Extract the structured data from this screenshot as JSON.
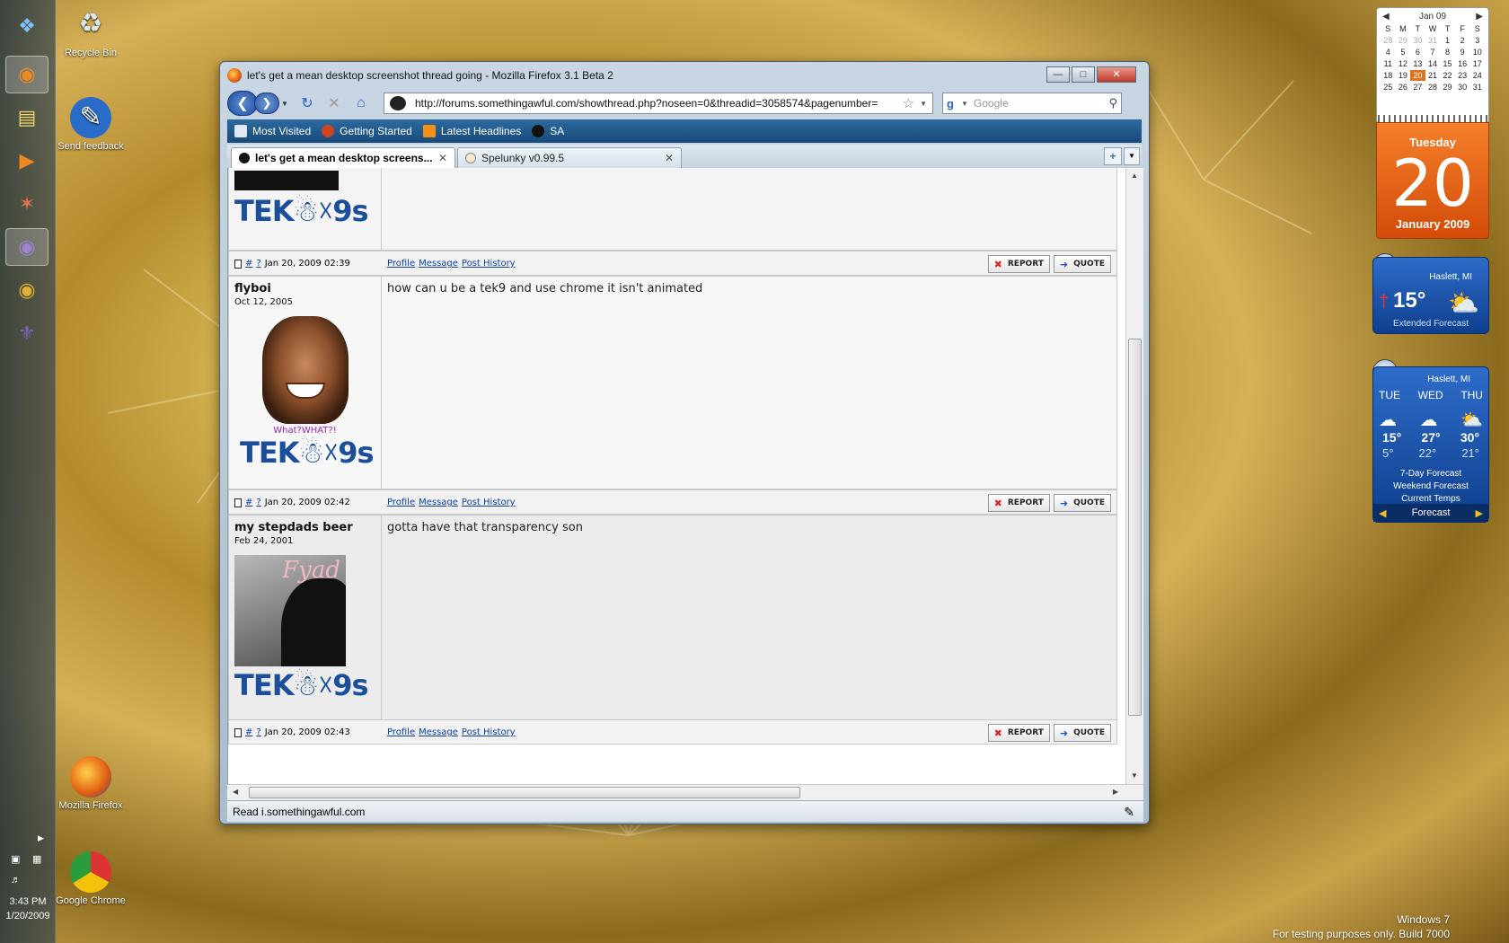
{
  "desktop": {
    "icons": [
      {
        "label": "Recycle Bin"
      },
      {
        "label": "Send feedback"
      },
      {
        "label": "Mozilla Firefox"
      },
      {
        "label": "Google Chrome"
      }
    ],
    "watermark": {
      "line1": "Windows 7",
      "line2": "For testing purposes only. Build 7000"
    }
  },
  "taskbar": {
    "clock_time": "3:43 PM",
    "clock_date": "1/20/2009"
  },
  "browser": {
    "window_title": "let's get a mean desktop screenshot thread going - Mozilla Firefox 3.1 Beta 2",
    "url": "http://forums.somethingawful.com/showthread.php?noseen=0&threadid=3058574&pagenumber=",
    "search_placeholder": "Google",
    "bookmarks": [
      "Most Visited",
      "Getting Started",
      "Latest Headlines",
      "SA"
    ],
    "tabs": [
      {
        "label": "let's get a mean desktop screens...",
        "selected": true
      },
      {
        "label": "Spelunky v0.99.5",
        "selected": false
      }
    ],
    "status": "Read i.somethingawful.com"
  },
  "forum": {
    "sig_text": "TEK☃☓9s",
    "footer_links": {
      "profile": "Profile",
      "message": "Message",
      "history": "Post History"
    },
    "footer_buttons": {
      "report": "REPORT",
      "quote": "QUOTE"
    },
    "footer_marks": {
      "hash": "#",
      "q": "?"
    },
    "posts": [
      {
        "timestamp": "Jan 20, 2009 02:39"
      },
      {
        "username": "flyboi",
        "regdate": "Oct 12, 2005",
        "caption": "What?WHAT?!",
        "body": "how can u be a tek9 and use chrome it isn't animated",
        "timestamp": "Jan 20, 2009 02:42"
      },
      {
        "username": "my stepdads beer",
        "regdate": "Feb 24, 2001",
        "avatar_text": "Fyad",
        "body": "gotta have that transparency son",
        "timestamp": "Jan 20, 2009 02:43"
      }
    ]
  },
  "gadgets": {
    "calendar": {
      "month": "Jan 09",
      "weekdays": [
        "S",
        "M",
        "T",
        "W",
        "T",
        "F",
        "S"
      ],
      "rows": [
        [
          "28",
          "29",
          "30",
          "31",
          "1",
          "2",
          "3"
        ],
        [
          "4",
          "5",
          "6",
          "7",
          "8",
          "9",
          "10"
        ],
        [
          "11",
          "12",
          "13",
          "14",
          "15",
          "16",
          "17"
        ],
        [
          "18",
          "19",
          "20",
          "21",
          "22",
          "23",
          "24"
        ],
        [
          "25",
          "26",
          "27",
          "28",
          "29",
          "30",
          "31"
        ]
      ],
      "today": "20",
      "big_day": "Tuesday",
      "big_num": "20",
      "big_month": "January 2009"
    },
    "weather_small": {
      "location": "Haslett, MI",
      "temp": "15°",
      "link": "Extended Forecast"
    },
    "weather_large": {
      "location": "Haslett, MI",
      "days": [
        "TUE",
        "WED",
        "THU"
      ],
      "highs": [
        "15°",
        "27°",
        "30°"
      ],
      "lows": [
        "5°",
        "22°",
        "21°"
      ],
      "links": [
        "7-Day Forecast",
        "Weekend Forecast",
        "Current Temps"
      ],
      "footer": "Forecast"
    }
  }
}
